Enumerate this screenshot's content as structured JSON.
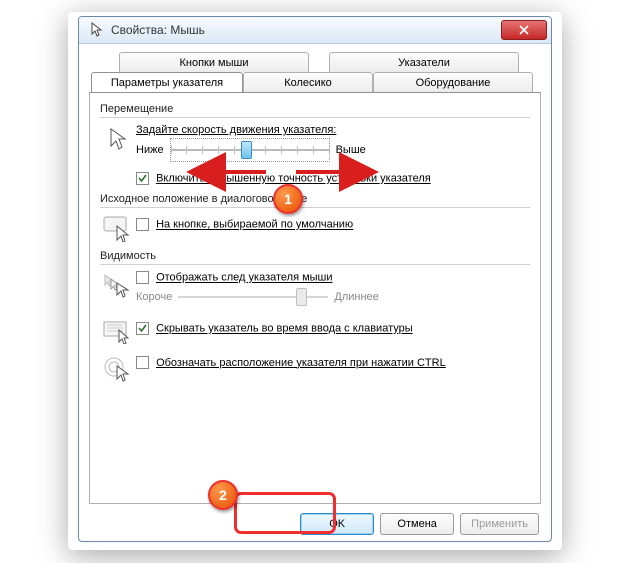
{
  "window": {
    "title": "Свойства: Мышь"
  },
  "tabs": {
    "row1": {
      "buttons": "Кнопки мыши",
      "pointers": "Указатели"
    },
    "row2": {
      "pointer_options": "Параметры указателя",
      "wheel": "Колесико",
      "hardware": "Оборудование"
    }
  },
  "groups": {
    "motion": {
      "title": "Перемещение",
      "speed_label": "Задайте скорость движения указателя:",
      "low": "Ниже",
      "high": "Выше",
      "enhance": "Включить повышенную точность установки указателя"
    },
    "snapto": {
      "title": "Исходное положение в диалоговом окне",
      "label": "На кнопке, выбираемой по умолчанию"
    },
    "visibility": {
      "title": "Видимость",
      "trails": "Отображать след указателя мыши",
      "shorter": "Короче",
      "longer": "Длиннее",
      "hide": "Скрывать указатель во время ввода с клавиатуры",
      "ctrl": "Обозначать расположение указателя при нажатии CTRL"
    }
  },
  "buttons": {
    "ok": "OK",
    "cancel": "Отмена",
    "apply": "Применить"
  },
  "annotations": {
    "one": "1",
    "two": "2"
  }
}
